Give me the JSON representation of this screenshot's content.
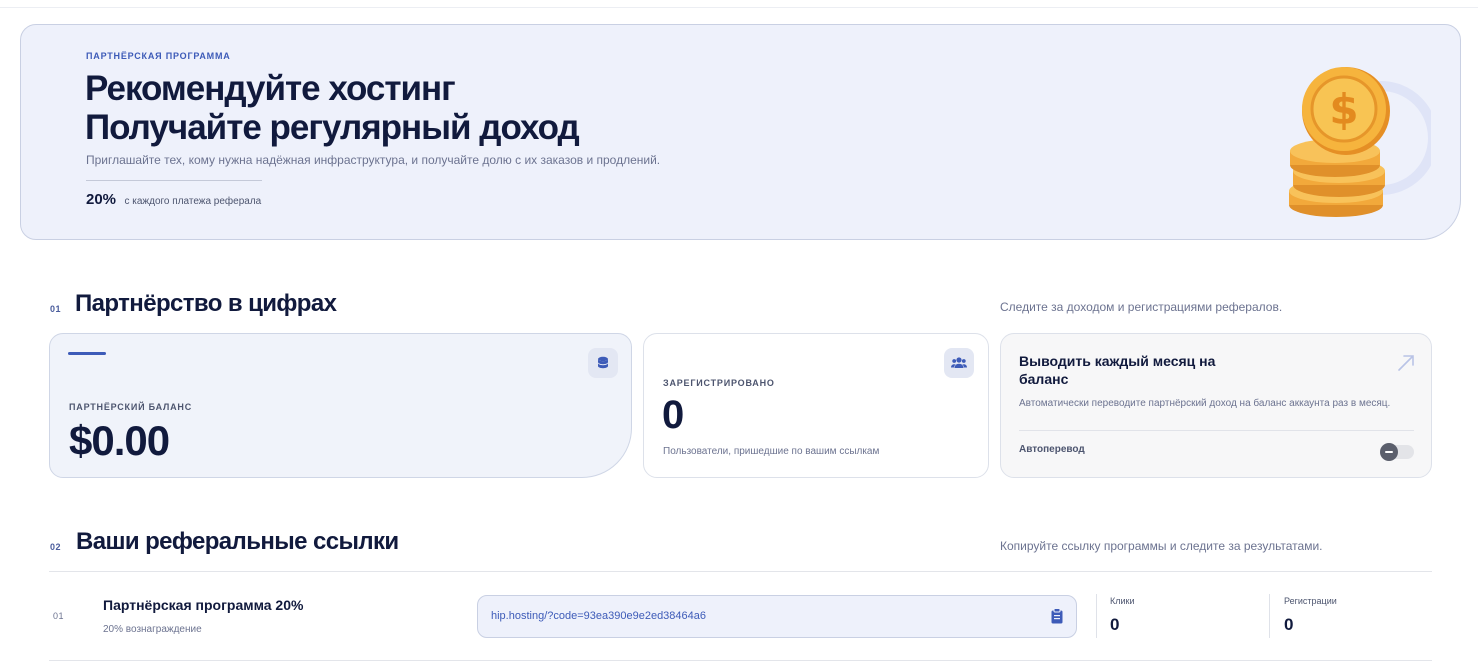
{
  "hero": {
    "eyebrow": "ПАРТНЁРСКАЯ ПРОГРАММА",
    "title_line1": "Рекомендуйте хостинг",
    "title_line2": "Получайте регулярный доход",
    "subtitle": "Приглашайте тех, кому нужна надёжная инфраструктура, и получайте долю с их заказов и продлений.",
    "stat_value": "20%",
    "stat_label": "с каждого платежа реферала",
    "illustration": "gold-coins-dollar"
  },
  "section1": {
    "number": "01",
    "title": "Партнёрство в цифрах",
    "hint": "Следите за доходом и регистрациями рефералов."
  },
  "balance_card": {
    "label": "ПАРТНЁРСКИЙ БАЛАНС",
    "value": "$0.00",
    "icon": "coins-icon"
  },
  "registered_card": {
    "label": "ЗАРЕГИСТРИРОВАНО",
    "value": "0",
    "caption": "Пользователи, пришедшие по вашим ссылкам",
    "icon": "users-icon"
  },
  "auto_card": {
    "title": "Выводить каждый месяц на баланс",
    "description": "Автоматически переводите партнёрский доход на баланс аккаунта раз в месяц.",
    "toggle_label": "Автоперевод",
    "toggle_on": false,
    "icon": "arrow-up-right-icon"
  },
  "section2": {
    "number": "02",
    "title": "Ваши реферальные ссылки",
    "hint": "Копируйте ссылку программы и следите за результатами."
  },
  "links": [
    {
      "number": "01",
      "name": "Партнёрская программа 20%",
      "reward": "20% вознаграждение",
      "url": "hip.hosting/?code=93ea390e9e2ed38464a6",
      "clicks_label": "Клики",
      "clicks": "0",
      "registrations_label": "Регистрации",
      "registrations": "0"
    }
  ],
  "colors": {
    "accent": "#3d5bb8",
    "hero_bg": "#eef1fb",
    "title": "#111a3d",
    "muted": "#6c7390",
    "coin": "#f5b03a"
  }
}
